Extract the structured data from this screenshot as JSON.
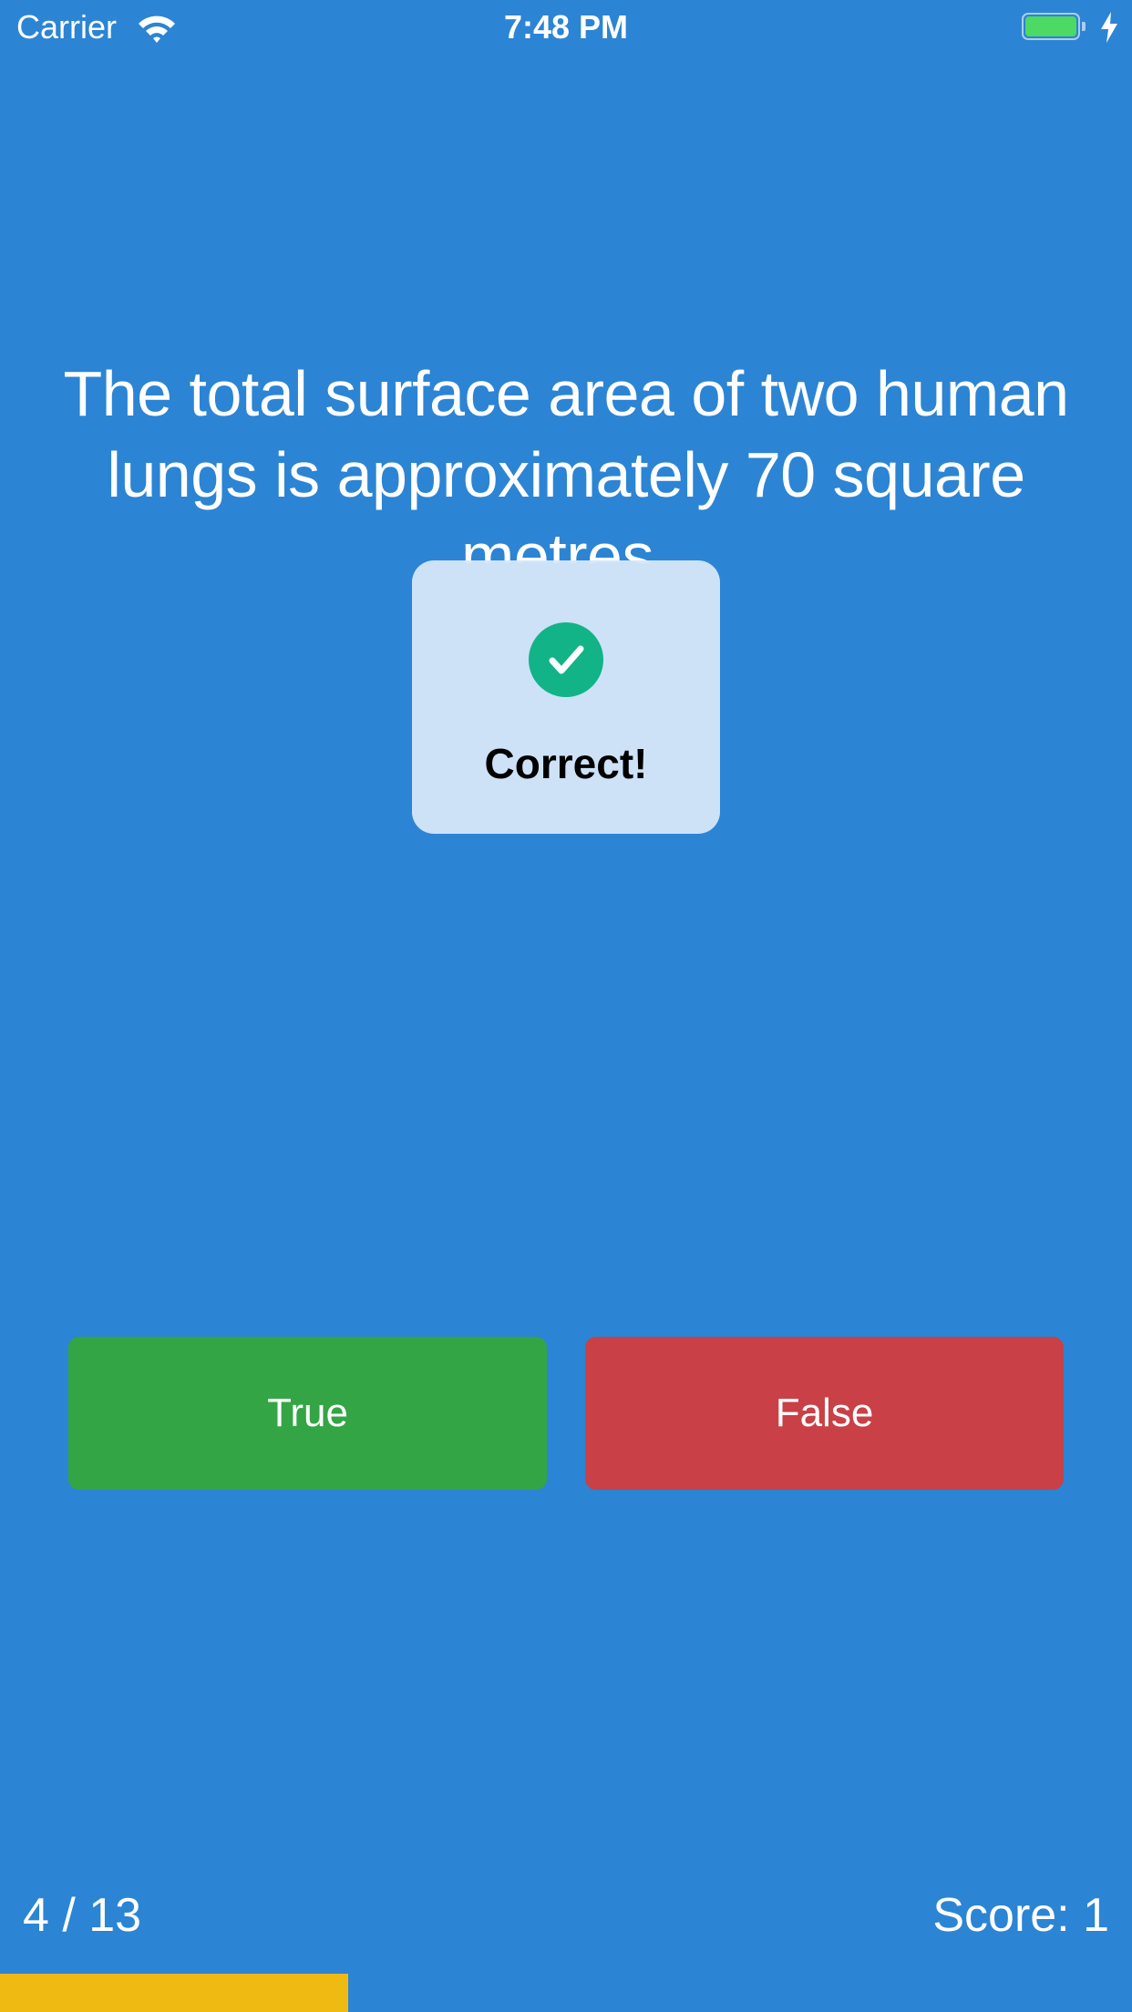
{
  "status_bar": {
    "carrier": "Carrier",
    "time": "7:48 PM",
    "wifi_icon": "wifi-icon",
    "battery_icon": "battery-icon",
    "charging_icon": "charging-bolt-icon",
    "battery_color": "#4cd964"
  },
  "question": {
    "text": "The total surface area of two human lungs is approximately 70 square metres."
  },
  "hud": {
    "icon": "checkmark-circle-icon",
    "message": "Correct!",
    "icon_color": "#12b387"
  },
  "buttons": {
    "true_label": "True",
    "false_label": "False",
    "true_color": "#33a544",
    "false_color": "#c94046"
  },
  "footer": {
    "progress_label": "4 / 13",
    "score_label": "Score: 1",
    "progress_fraction": 0.3077,
    "progress_color": "#efbb13"
  },
  "background_color": "#2c84d4"
}
